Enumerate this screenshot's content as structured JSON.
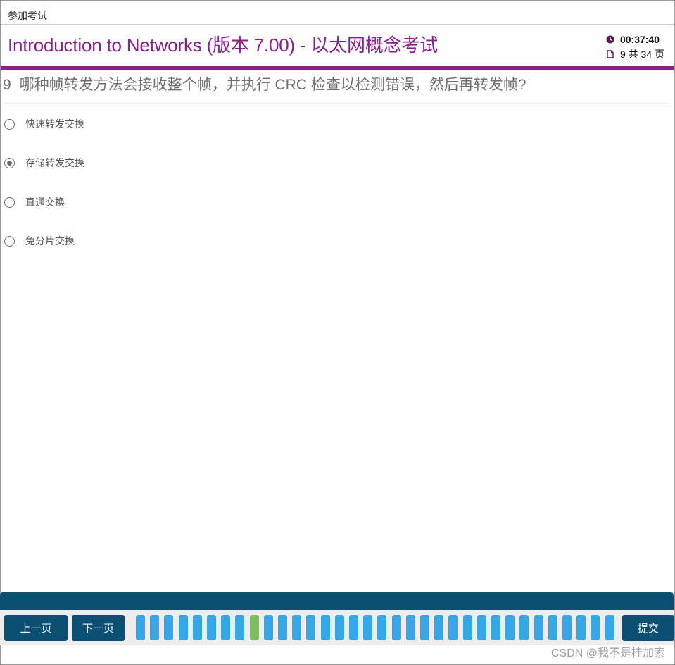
{
  "window": {
    "title": "参加考试"
  },
  "exam": {
    "title": "Introduction to Networks (版本 7.00) - 以太网概念考试",
    "timer": "00:37:40",
    "page_info": "9 共 34 页"
  },
  "question": {
    "number": "9",
    "text": "哪种帧转发方法会接收整个帧，并执行 CRC 检查以检测错误，然后再转发帧?",
    "options": [
      {
        "label": "快速转发交换",
        "checked": false
      },
      {
        "label": "存储转发交换",
        "checked": true
      },
      {
        "label": "直通交换",
        "checked": false
      },
      {
        "label": "免分片交换",
        "checked": false
      }
    ]
  },
  "footer": {
    "prev_label": "上一页",
    "next_label": "下一页",
    "submit_label": "提交",
    "total_pages": 34,
    "current_page": 9,
    "tab_count": 34
  },
  "watermark": "CSDN @我不是桂加索",
  "colors": {
    "brand_purple": "#8a1e8a",
    "nav_dark": "#0b4f72",
    "page_tab": "#35a6e6",
    "page_tab_current": "#7cbe5b"
  },
  "icons": {
    "timer": "clock-icon",
    "pages": "document-icon"
  }
}
